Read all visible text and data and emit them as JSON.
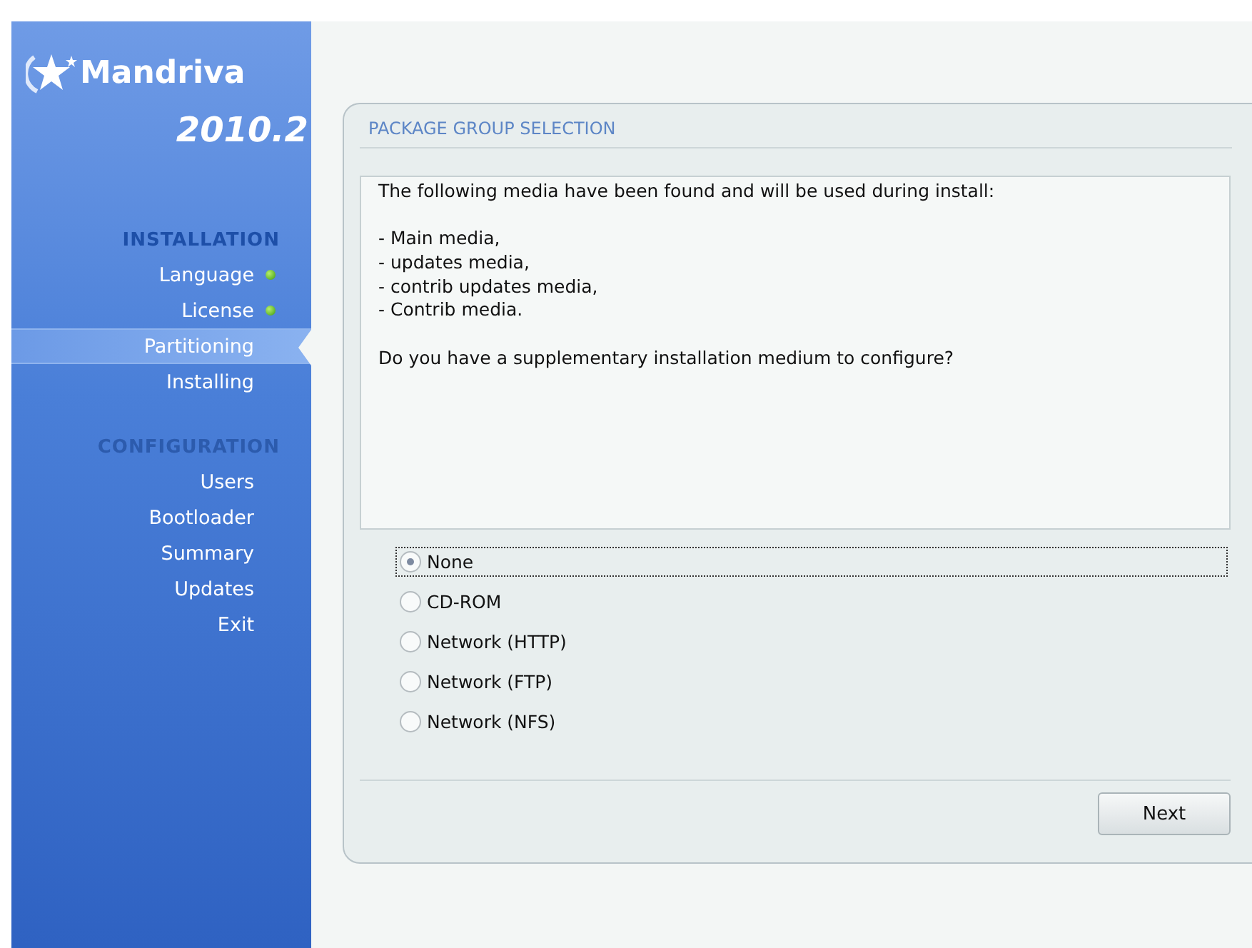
{
  "brand": {
    "name": "Mandriva",
    "version": "2010.2"
  },
  "sidebar": {
    "sections": [
      {
        "title": "INSTALLATION",
        "current": true,
        "items": [
          {
            "label": "Language",
            "done": true,
            "selected": false
          },
          {
            "label": "License",
            "done": true,
            "selected": false
          },
          {
            "label": "Partitioning",
            "done": false,
            "selected": true
          },
          {
            "label": "Installing",
            "done": false,
            "selected": false
          }
        ]
      },
      {
        "title": "CONFIGURATION",
        "current": false,
        "items": [
          {
            "label": "Users",
            "done": false,
            "selected": false
          },
          {
            "label": "Bootloader",
            "done": false,
            "selected": false
          },
          {
            "label": "Summary",
            "done": false,
            "selected": false
          },
          {
            "label": "Updates",
            "done": false,
            "selected": false
          },
          {
            "label": "Exit",
            "done": false,
            "selected": false
          }
        ]
      }
    ]
  },
  "panel": {
    "title": "PACKAGE GROUP SELECTION",
    "message": [
      [
        "The following media have been found and will be used during install:"
      ],
      [
        "- Main media,",
        "- updates media,",
        "- contrib updates media,",
        "- Contrib media."
      ],
      [
        "Do you have a supplementary installation medium to configure?"
      ]
    ],
    "options": [
      {
        "label": "None",
        "selected": true
      },
      {
        "label": "CD-ROM",
        "selected": false
      },
      {
        "label": "Network (HTTP)",
        "selected": false
      },
      {
        "label": "Network (FTP)",
        "selected": false
      },
      {
        "label": "Network (NFS)",
        "selected": false
      }
    ],
    "buttons": [
      "Next"
    ]
  }
}
